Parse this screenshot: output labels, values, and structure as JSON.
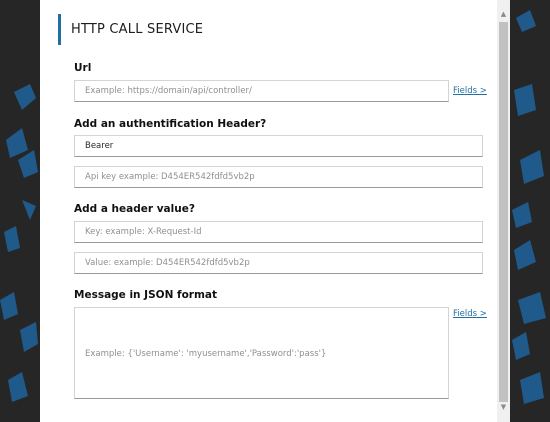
{
  "dialog": {
    "title": "HTTP CALL SERVICE"
  },
  "url_section": {
    "label": "Url",
    "placeholder": "Example: https://domain/api/controller/",
    "fields_link": "Fields >"
  },
  "auth_section": {
    "label": "Add an authentification Header?",
    "type_value": "Bearer",
    "api_key_placeholder": "Api key example: D454ER542fdfd5vb2p"
  },
  "header_section": {
    "label": "Add a header value?",
    "key_placeholder": "Key: example: X-Request-Id",
    "value_placeholder": "Value: example: D454ER542fdfd5vb2p"
  },
  "message_section": {
    "label": "Message in JSON format",
    "placeholder": "Example: {'Username': 'myusername','Password':'pass'}",
    "fields_link": "Fields >"
  },
  "scrollbar": {
    "up_glyph": "▲",
    "down_glyph": "▼"
  },
  "colors": {
    "accent": "#1f6fa3",
    "backdrop": "#262626",
    "backdrop_shapes": "#1f5a8a"
  }
}
